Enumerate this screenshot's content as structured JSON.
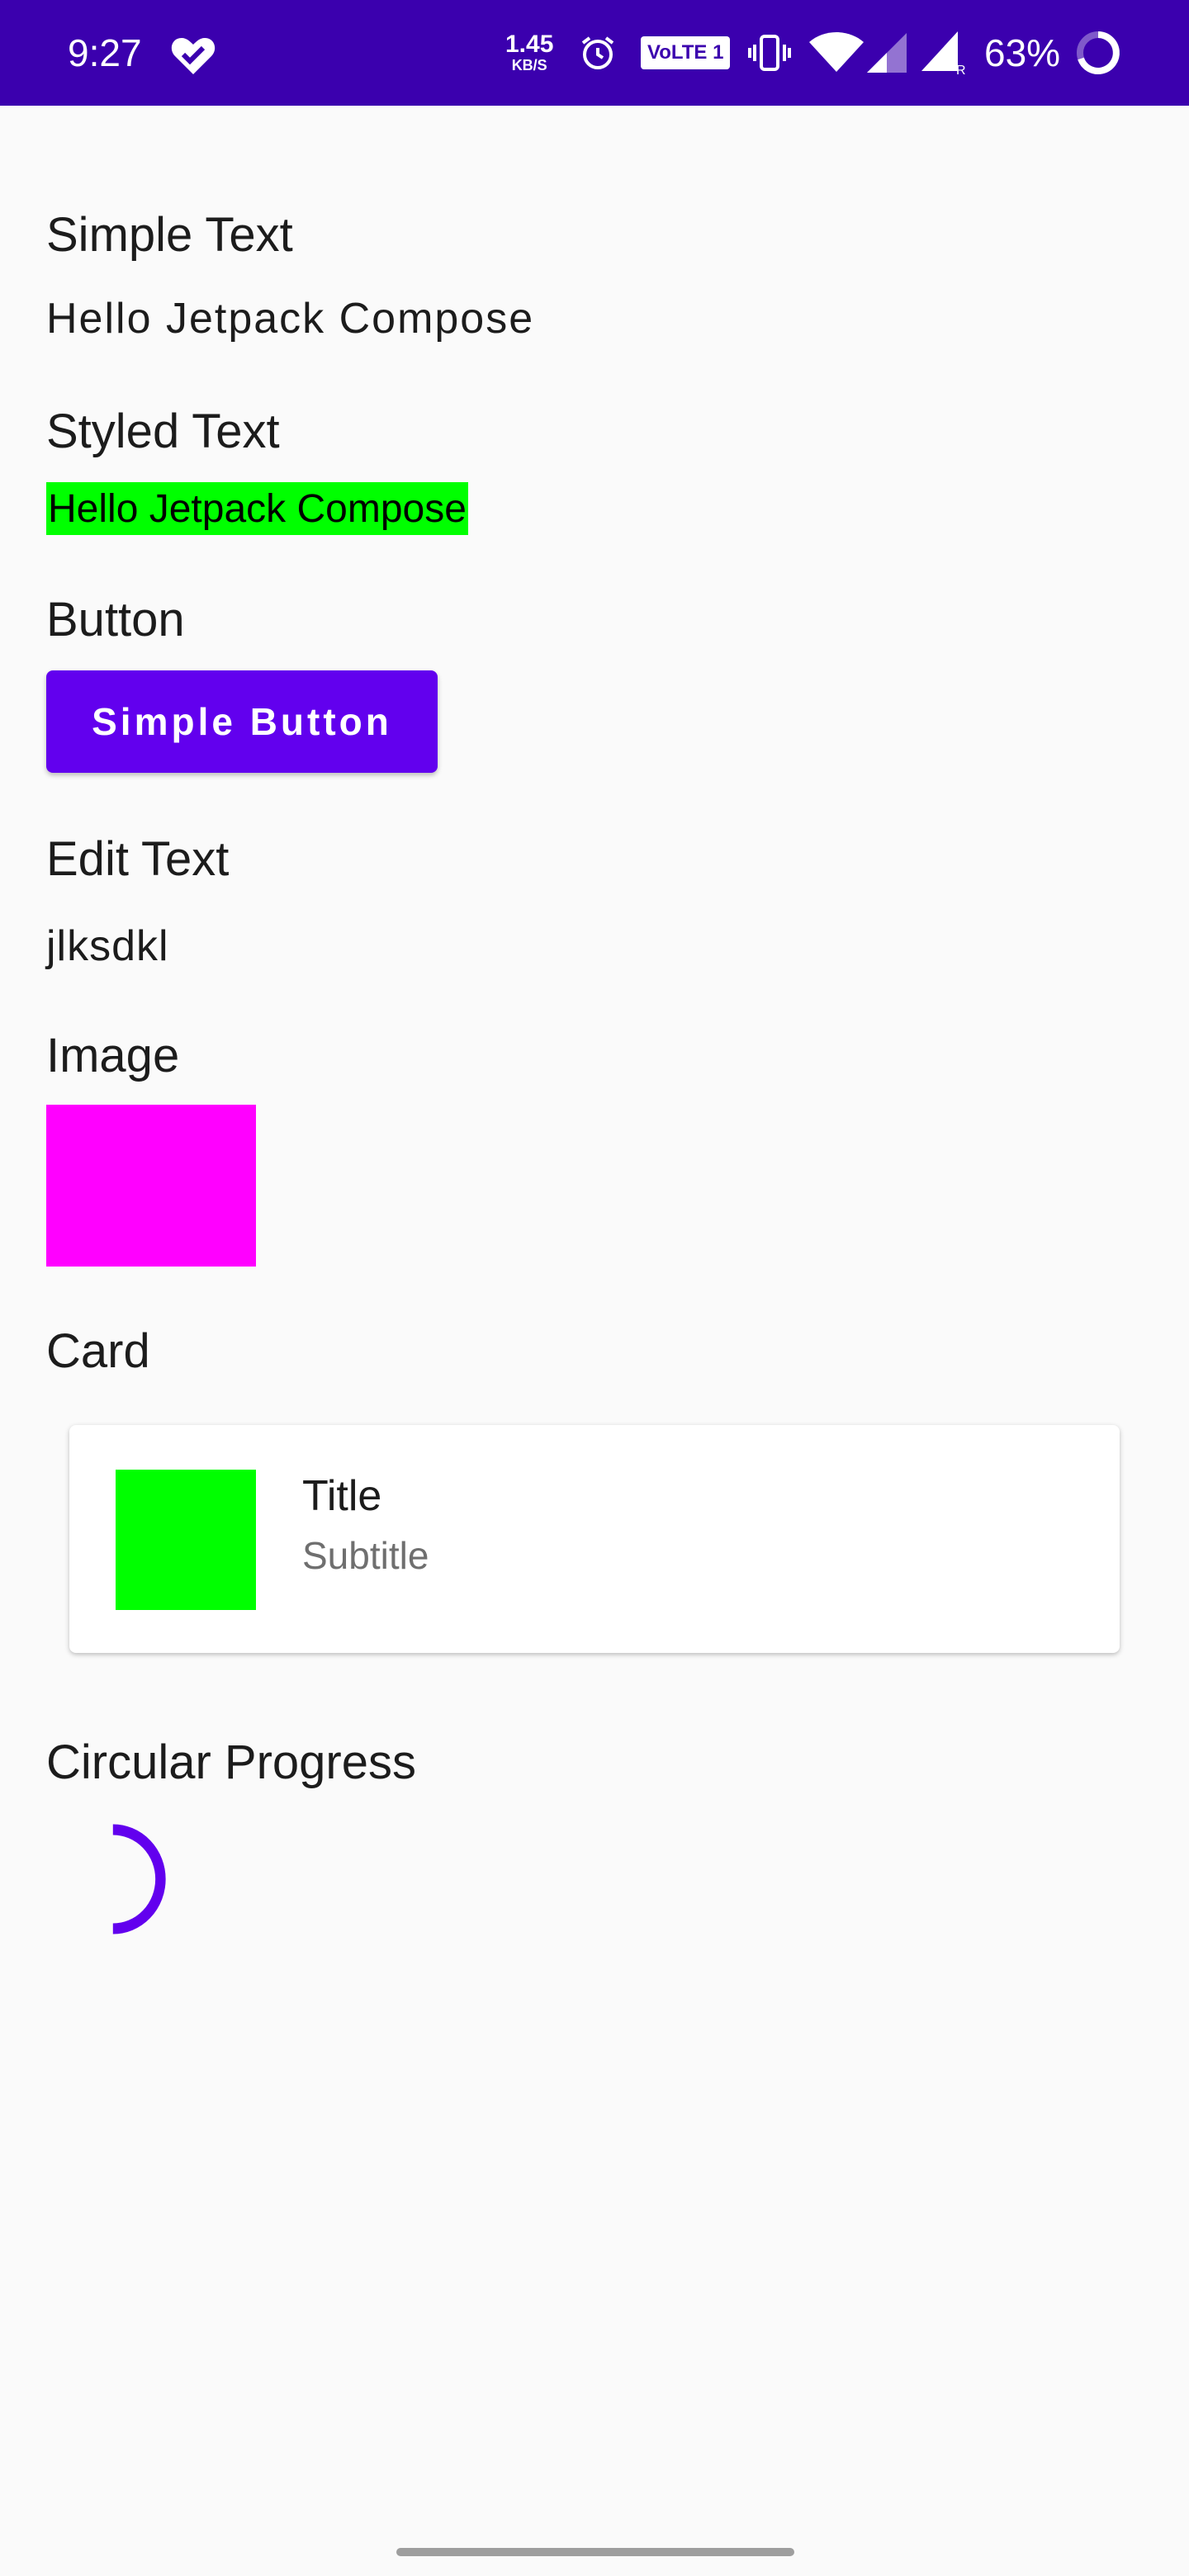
{
  "status_bar": {
    "time": "9:27",
    "net_speed_value": "1.45",
    "net_speed_unit": "KB/S",
    "volte_label": "VoLTE 1",
    "battery": "63%",
    "background": "#3B00AE",
    "icons": [
      "heart-check-icon",
      "alarm-icon",
      "volte-icon",
      "vibrate-icon",
      "wifi-icon",
      "signal-icon",
      "signal-roaming-icon",
      "battery-ring-icon"
    ]
  },
  "sections": {
    "simple_text": {
      "label": "Simple Text",
      "value": "Hello Jetpack Compose"
    },
    "styled_text": {
      "label": "Styled Text",
      "value": "Hello Jetpack Compose",
      "highlight": "#00FF00"
    },
    "button": {
      "label": "Button",
      "button_text": "Simple Button",
      "color": "#6200EE"
    },
    "edit_text": {
      "label": "Edit Text",
      "value": "jlksdkl"
    },
    "image": {
      "label": "Image",
      "color": "#FF00FF"
    },
    "card": {
      "label": "Card",
      "title": "Title",
      "subtitle": "Subtitle",
      "thumb_color": "#00FF00"
    },
    "circular_progress": {
      "label": "Circular Progress",
      "color": "#6200EE"
    }
  }
}
